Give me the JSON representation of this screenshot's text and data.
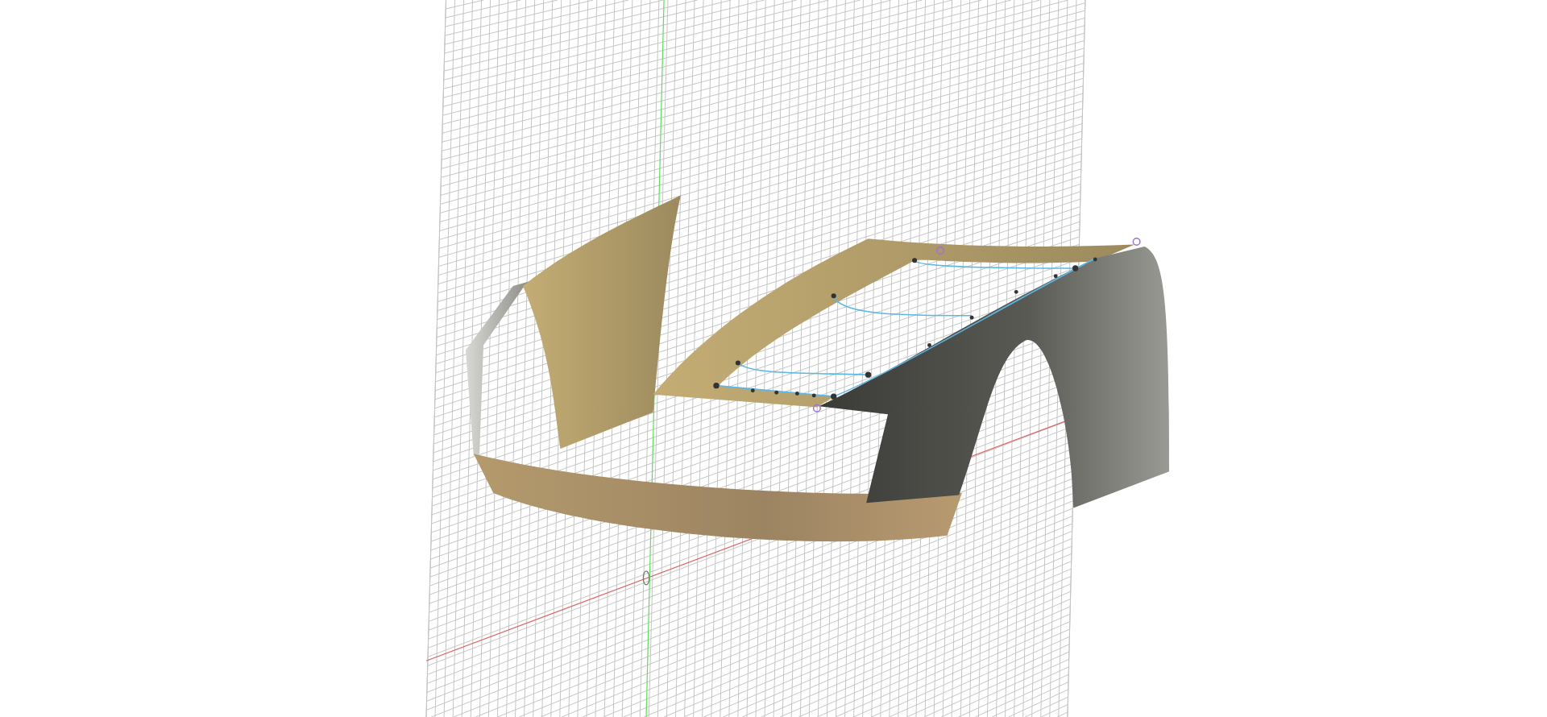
{
  "viewport": {
    "grid_visible": true,
    "axes": [
      {
        "kind": "horizontal",
        "color": "#e06060"
      },
      {
        "kind": "vertical",
        "color": "#5ee05e"
      }
    ]
  }
}
